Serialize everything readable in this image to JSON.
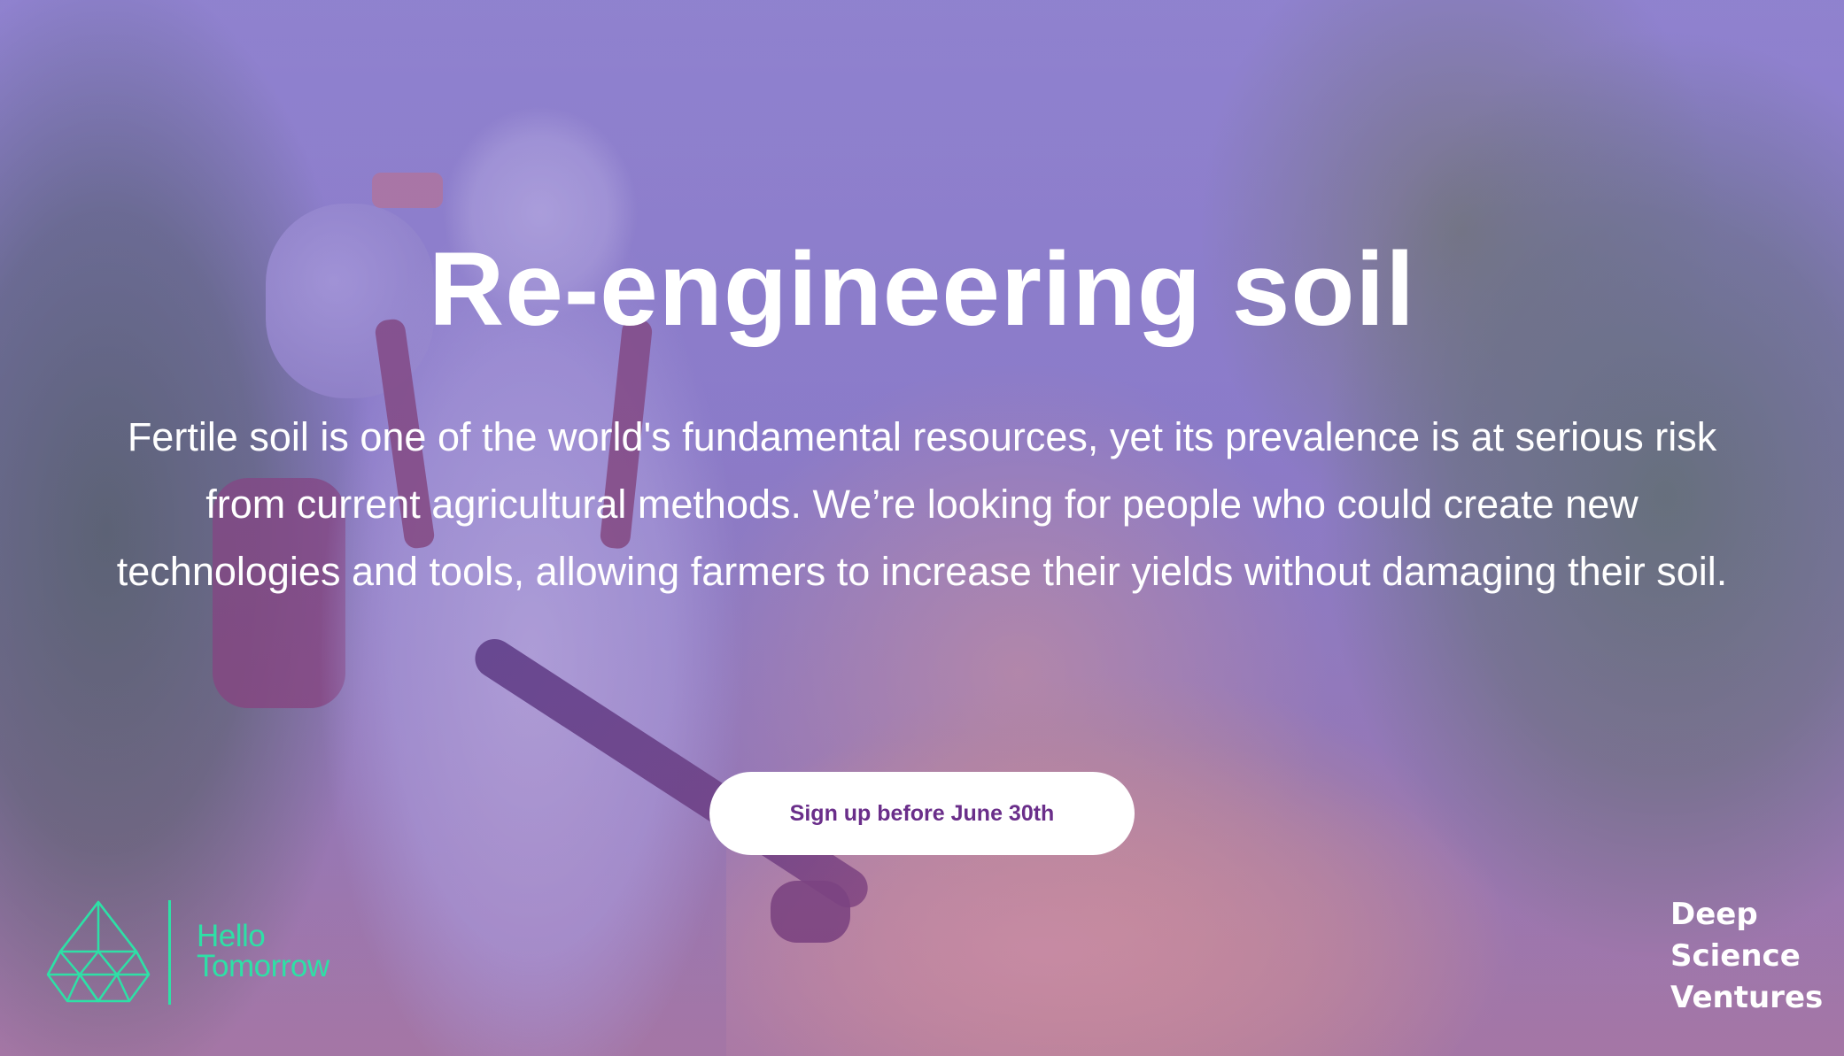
{
  "hero": {
    "headline": "Re-engineering soil",
    "description": "Fertile soil is one of the world's fundamental resources, yet its prevalence is at serious risk from current agricultural methods. We’re looking for people who could create new technologies and tools, allowing farmers to increase their yields without damaging their soil.",
    "cta_label": "Sign up before June 30th"
  },
  "logos": {
    "left": {
      "line1": "Hello",
      "line2": "Tomorrow",
      "icon": "diamond-gem-icon"
    },
    "right": {
      "line1": "Deep",
      "line2": "Science",
      "line3": "Ventures"
    }
  },
  "colors": {
    "overlay_tint": "#7a5ac8",
    "cta_background": "#ffffff",
    "cta_text": "#6a2e8a",
    "hello_tomorrow_green": "#2ee0a6",
    "text_white": "#ffffff"
  }
}
